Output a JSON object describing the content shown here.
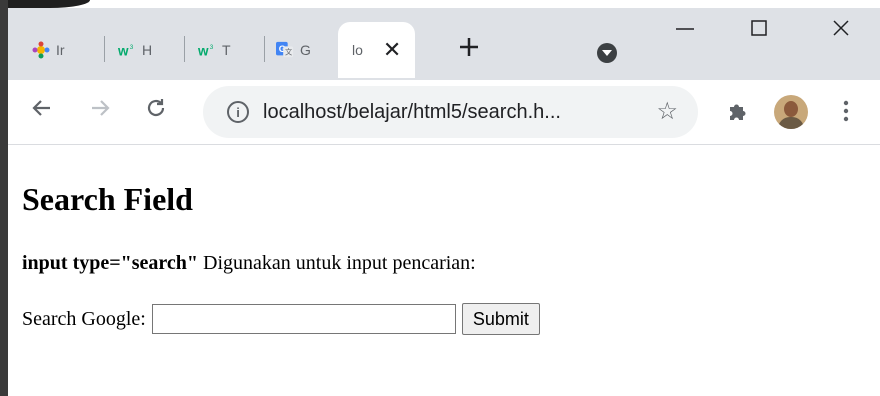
{
  "browser": {
    "tabs": [
      {
        "label": "Ir",
        "icon": "colorful-gear-icon"
      },
      {
        "label": "H",
        "icon": "w3-icon"
      },
      {
        "label": "T",
        "icon": "w3-icon"
      },
      {
        "label": "G",
        "icon": "google-translate-icon"
      },
      {
        "label": "lo",
        "icon": "none",
        "active": true
      }
    ],
    "address": "localhost/belajar/html5/search.h...",
    "colors": {
      "titlebar": "#dee1e6",
      "w3_green": "#04aa6d"
    }
  },
  "page": {
    "heading": "Search Field",
    "description_bold": "input type=\"search\"",
    "description_rest": " Digunakan untuk input pencarian:",
    "search_label": "Search Google:",
    "search_value": "",
    "submit_label": "Submit"
  }
}
